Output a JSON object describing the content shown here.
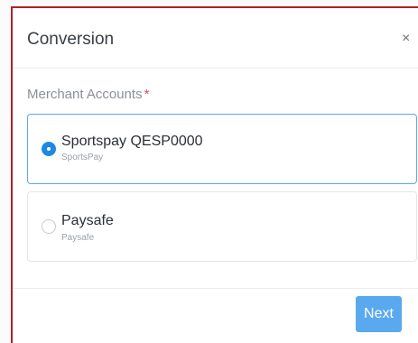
{
  "modal": {
    "title": "Conversion",
    "close_glyph": "×"
  },
  "field": {
    "label": "Merchant Accounts",
    "required_marker": "*"
  },
  "options": [
    {
      "title": "Sportspay QESP0000",
      "subtitle": "SportsPay",
      "selected": true
    },
    {
      "title": "Paysafe",
      "subtitle": "Paysafe",
      "selected": false
    }
  ],
  "footer": {
    "next_label": "Next"
  },
  "colors": {
    "accent": "#1e88e5",
    "button": "#5aa9ef",
    "border_selected": "#5fa6f0",
    "required": "#e5484d",
    "frame": "#b3202a"
  },
  "icons": {
    "close": "close-icon",
    "radio_selected": "radio-selected-icon",
    "radio_unselected": "radio-unselected-icon"
  }
}
